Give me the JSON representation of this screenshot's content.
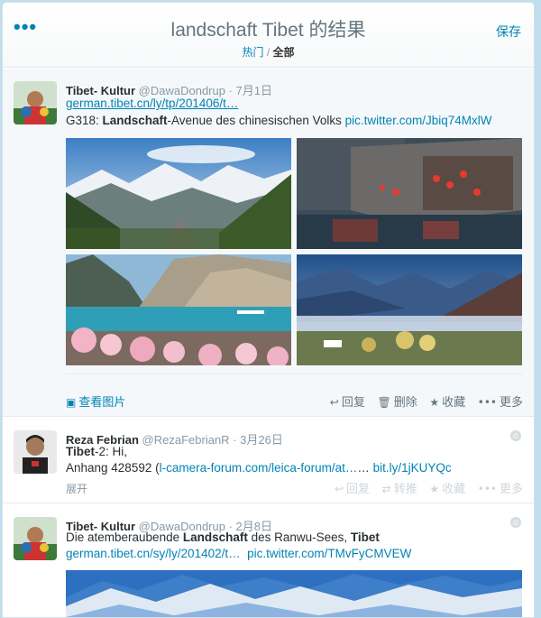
{
  "header": {
    "menu_icon": "more-dots-icon",
    "title_query": "landschaft Tibet",
    "title_suffix": " 的结果",
    "tab_top": "热门",
    "tab_sep": " / ",
    "tab_all": "全部",
    "save_label": "保存"
  },
  "tweets": [
    {
      "name": "Tibet- Kultur",
      "handle": "@DawaDondrup",
      "time": "· 7月1日",
      "link1": "german.tibet.cn/ly/tp/201406/t…",
      "text_prefix": "G318: ",
      "text_bold": "Landschaft",
      "text_rest": "-Avenue des chinesischen Volks ",
      "pic_link": "pic.twitter.com/Jbiq74MxlW",
      "view_photos": "查看图片",
      "reply": "回复",
      "delete": "删除",
      "favorite": "收藏",
      "more": "更多"
    },
    {
      "name": "Reza Febrian",
      "handle": "@RezaFebrianR",
      "time": "· 3月26日",
      "line1_bold": "Tibet",
      "line1_rest": "-2: Hi,",
      "line2_prefix": "Anhang 428592 (",
      "line2_link": "l-camera-forum.com/leica-forum/at…",
      "line2_mid": "… ",
      "line2_link2": "bit.ly/1jKUYQc",
      "expand": "展开",
      "reply": "回复",
      "retweet": "转推",
      "favorite": "收藏",
      "more": "更多"
    },
    {
      "name": "Tibet- Kultur",
      "handle": "@DawaDondrup",
      "time": "· 2月8日",
      "line1_prefix": "Die atemberaubende ",
      "line1_bold": "Landschaft",
      "line1_mid": " des Ranwu-Sees, ",
      "line1_bold2": "Tibet",
      "link1": "german.tibet.cn/sy/ly/201402/t…",
      "pic_link": "pic.twitter.com/TMvFyCMVEW"
    }
  ]
}
